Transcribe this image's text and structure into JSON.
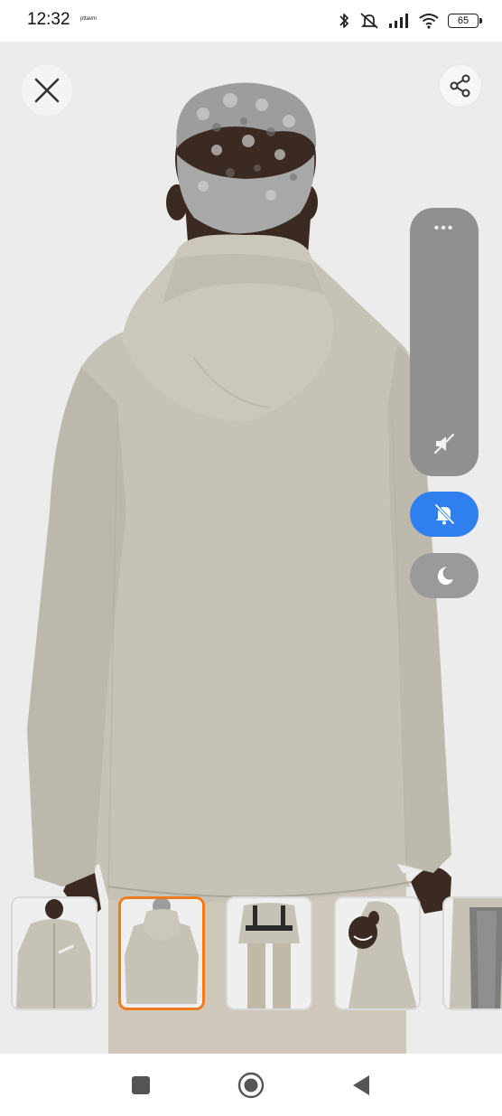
{
  "status_bar": {
    "time": "12:32",
    "carrier": "pttavm",
    "battery": "65",
    "icons": [
      "bluetooth-icon",
      "silent-vibrate-icon",
      "signal-icon",
      "wifi-icon",
      "battery-icon"
    ]
  },
  "viewer": {
    "close_icon": "close-icon",
    "share_icon": "share-icon",
    "image_subject": "back view of beige hooded rain jacket"
  },
  "side_panel": {
    "dots": "•••",
    "volume_icon": "volume-mute-icon",
    "dnd_icon": "bell-off-icon",
    "dnd_color": "#2f80ee",
    "night_icon": "moon-icon"
  },
  "thumbnails": {
    "selected_index": 1,
    "selected_color": "#f07a1e",
    "items": [
      "front view",
      "back view",
      "with backpack",
      "side view hood",
      "inner lining"
    ]
  },
  "nav_bar": {
    "icons": [
      "recent-apps-icon",
      "home-icon",
      "back-icon"
    ]
  }
}
